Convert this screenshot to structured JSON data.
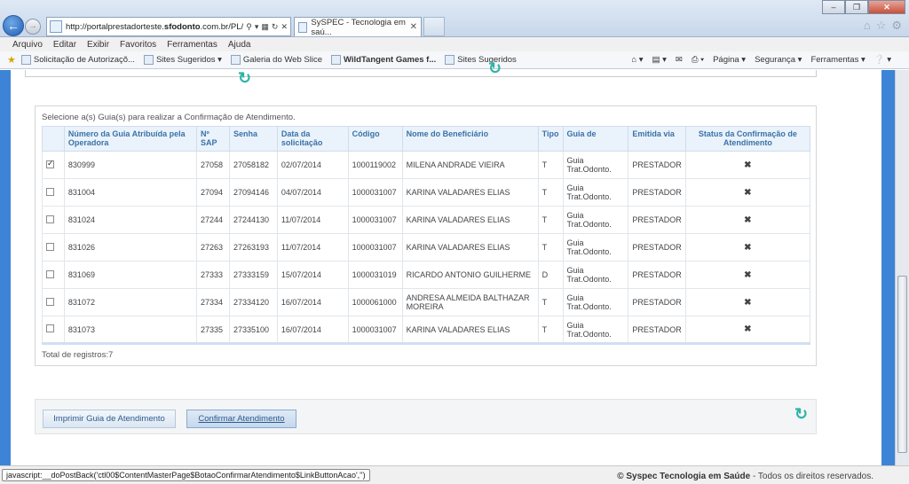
{
  "browser": {
    "url": "http://portalprestadorteste.sfodonto.com.br/PL/",
    "url_host_bold": "sfodonto",
    "tab_title": "SySPEC - Tecnologia em saú...",
    "menu": [
      "Arquivo",
      "Editar",
      "Exibir",
      "Favoritos",
      "Ferramentas",
      "Ajuda"
    ],
    "favorites": [
      "Solicitação de Autorizaçõ...",
      "Sites Sugeridos",
      "Galeria do Web Slice",
      "WildTangent Games f...",
      "Sites Sugeridos"
    ],
    "tools": [
      "Página",
      "Segurança",
      "Ferramentas"
    ]
  },
  "grid": {
    "intro": "Selecione a(s) Guia(s) para realizar a Confirmação de Atendimento.",
    "headers": [
      "",
      "Número da Guia Atribuída pela Operadora",
      "Nº SAP",
      "Senha",
      "Data da solicitação",
      "Código",
      "Nome do Beneficiário",
      "Tipo",
      "Guia de",
      "Emitida via",
      "Status da Confirmação de Atendimento"
    ],
    "rows": [
      {
        "checked": true,
        "numero": "830999",
        "sap": "27058",
        "senha": "27058182",
        "data": "02/07/2014",
        "codigo": "1000119002",
        "nome": "MILENA ANDRADE VIEIRA",
        "tipo": "T",
        "guia": "Guia Trat.Odonto.",
        "via": "PRESTADOR",
        "status": "✖"
      },
      {
        "checked": false,
        "numero": "831004",
        "sap": "27094",
        "senha": "27094146",
        "data": "04/07/2014",
        "codigo": "1000031007",
        "nome": "KARINA VALADARES ELIAS",
        "tipo": "T",
        "guia": "Guia Trat.Odonto.",
        "via": "PRESTADOR",
        "status": "✖"
      },
      {
        "checked": false,
        "numero": "831024",
        "sap": "27244",
        "senha": "27244130",
        "data": "11/07/2014",
        "codigo": "1000031007",
        "nome": "KARINA VALADARES ELIAS",
        "tipo": "T",
        "guia": "Guia Trat.Odonto.",
        "via": "PRESTADOR",
        "status": "✖"
      },
      {
        "checked": false,
        "numero": "831026",
        "sap": "27263",
        "senha": "27263193",
        "data": "11/07/2014",
        "codigo": "1000031007",
        "nome": "KARINA VALADARES ELIAS",
        "tipo": "T",
        "guia": "Guia Trat.Odonto.",
        "via": "PRESTADOR",
        "status": "✖"
      },
      {
        "checked": false,
        "numero": "831069",
        "sap": "27333",
        "senha": "27333159",
        "data": "15/07/2014",
        "codigo": "1000031019",
        "nome": "RICARDO ANTONIO GUILHERME",
        "tipo": "D",
        "guia": "Guia Trat.Odonto.",
        "via": "PRESTADOR",
        "status": "✖"
      },
      {
        "checked": false,
        "numero": "831072",
        "sap": "27334",
        "senha": "27334120",
        "data": "16/07/2014",
        "codigo": "1000061000",
        "nome": "ANDRESA ALMEIDA BALTHAZAR MOREIRA",
        "tipo": "T",
        "guia": "Guia Trat.Odonto.",
        "via": "PRESTADOR",
        "status": "✖"
      },
      {
        "checked": false,
        "numero": "831073",
        "sap": "27335",
        "senha": "27335100",
        "data": "16/07/2014",
        "codigo": "1000031007",
        "nome": "KARINA VALADARES ELIAS",
        "tipo": "T",
        "guia": "Guia Trat.Odonto.",
        "via": "PRESTADOR",
        "status": "✖"
      }
    ],
    "total": "Total de registros:7"
  },
  "actions": {
    "print_label": "Imprimir Guia de Atendimento",
    "confirm_label": "Confirmar Atendimento"
  },
  "status": {
    "link": "javascript:__doPostBack('ctl00$ContentMasterPage$BotaoConfirmarAtendimento$LinkButtonAcao','')",
    "copyright_brand": "© Syspec Tecnologia em Saúde",
    "copyright_rest": " - Todos os direitos reservados."
  },
  "colors": {
    "header_text": "#3b71a8",
    "status_error": "#d4161a",
    "accent_refresh": "#2fb3a7",
    "viewport_bg": "#3d84d6"
  }
}
